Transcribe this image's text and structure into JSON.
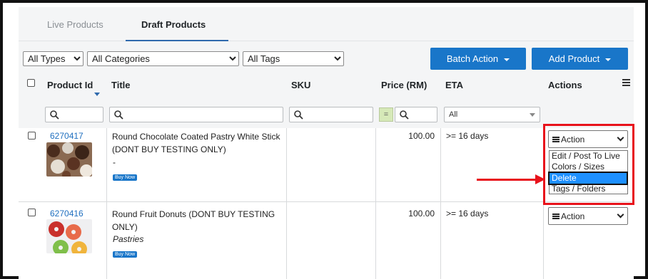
{
  "tabs": [
    {
      "label": "Live Products",
      "active": false
    },
    {
      "label": "Draft Products",
      "active": true
    }
  ],
  "filters": {
    "types": "All Types",
    "categories": "All Categories",
    "tags": "All Tags"
  },
  "toolbar": {
    "batch_action": "Batch Action",
    "add_product": "Add Product"
  },
  "columns": {
    "product_id": "Product Id",
    "title": "Title",
    "sku": "SKU",
    "price": "Price (RM)",
    "eta": "ETA",
    "actions": "Actions"
  },
  "search": {
    "price_eq": "=",
    "eta_option": "All"
  },
  "rows": [
    {
      "id": "6270417",
      "title_line1": "Round Chocolate Coated Pastry White Stick",
      "title_line2": "(DONT BUY TESTING ONLY)",
      "category": "-",
      "badge": "Buy Now",
      "price": "100.00",
      "eta": ">= 16 days",
      "action": "Action"
    },
    {
      "id": "6270416",
      "title_line1": "Round Fruit Donuts (DONT BUY TESTING",
      "title_line2": "ONLY)",
      "category": "Pastries",
      "badge": "Buy Now",
      "price": "100.00",
      "eta": ">= 16 days",
      "action": "Action"
    }
  ],
  "action_menu": {
    "items": [
      "Edit / Post To Live",
      "Colors / Sizes",
      "Delete",
      "Tags / Folders"
    ],
    "selected": "Delete"
  },
  "colors": {
    "accent": "#1976c9",
    "highlight": "#1e90ff",
    "annotation": "#e8121b"
  }
}
